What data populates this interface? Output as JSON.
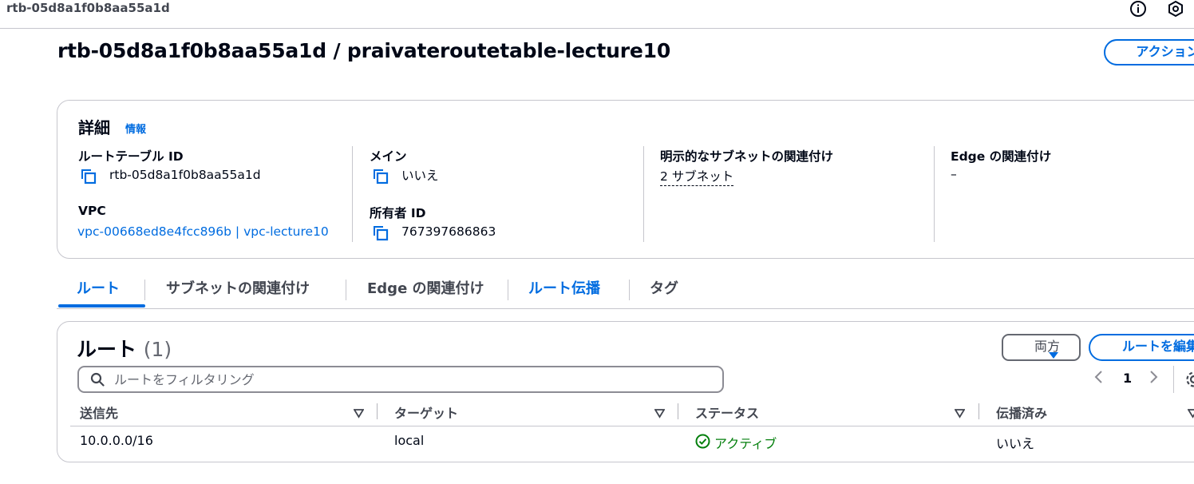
{
  "topbar": {
    "title": "rtb-05d8a1f0b8aa55a1d",
    "icons": [
      "info-circle-icon",
      "settings-hex-icon"
    ]
  },
  "page": {
    "title": "rtb-05d8a1f0b8aa55a1d / praivateroutetable-lecture10",
    "action_label": "アクション"
  },
  "details": {
    "title": "詳細",
    "info_link": "情報",
    "route_table_id_label": "ルートテーブル ID",
    "route_table_id": "rtb-05d8a1f0b8aa55a1d",
    "vpc_label": "VPC",
    "vpc_value": "vpc-00668ed8e4fcc896b | vpc-lecture10",
    "main_label": "メイン",
    "main_value": "いいえ",
    "owner_label": "所有者 ID",
    "owner_value": "767397686863",
    "explicit_subnet_label": "明示的なサブネットの関連付け",
    "explicit_subnet_value": "2 サブネット",
    "edge_label": "Edge の関連付け",
    "edge_value": "–"
  },
  "tabs": [
    {
      "label": "ルート",
      "active": true
    },
    {
      "label": "サブネットの関連付け",
      "active": false
    },
    {
      "label": "Edge の関連付け",
      "active": false
    },
    {
      "label": "ルート伝播",
      "active": false
    },
    {
      "label": "タグ",
      "active": false
    }
  ],
  "routes": {
    "title": "ルート",
    "count": "(1)",
    "filter_button": "両方",
    "edit_button": "ルートを編集",
    "search_placeholder": "ルートをフィルタリング",
    "page": "1",
    "columns": [
      "送信先",
      "ターゲット",
      "ステータス",
      "伝播済み"
    ],
    "rows": [
      {
        "destination": "10.0.0.0/16",
        "target": "local",
        "status": "アクティブ",
        "propagated": "いいえ"
      }
    ]
  },
  "colors": {
    "accent": "#006ce0",
    "success": "#037f0c",
    "text": "#000716",
    "border": "#c6c6cd"
  }
}
